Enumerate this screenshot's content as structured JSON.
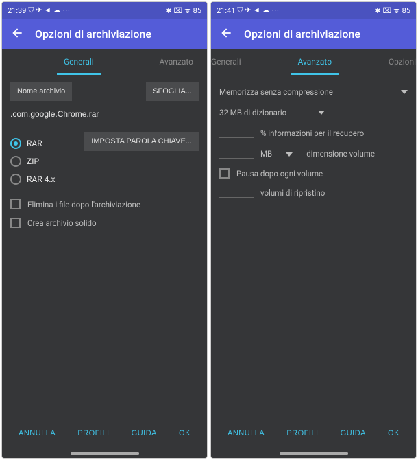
{
  "left": {
    "status_time": "21:39",
    "status_icons_left": "⛉ ✈ ◄ ☁ ⋯",
    "status_icons_right": "✱ ⌧ ᯤ 85",
    "title": "Opzioni di archiviazione",
    "tabs": {
      "generali": "Generali",
      "avanzato": "Avanzato"
    },
    "name_label": "Nome archivio",
    "browse": "SFOGLIA...",
    "filename": ".com.google.Chrome.rar",
    "formats": {
      "rar": "RAR",
      "zip": "ZIP",
      "rar4": "RAR 4.x"
    },
    "password_btn": "IMPOSTA PAROLA CHIAVE...",
    "delete_after": "Elimina i file dopo l'archiviazione",
    "solid": "Crea archivio solido",
    "footer": {
      "cancel": "ANNULLA",
      "profiles": "PROFILI",
      "help": "GUIDA",
      "ok": "OK"
    }
  },
  "right": {
    "status_time": "21:41",
    "status_icons_left": "⛉ ✈ ◄ ☁ ⋯",
    "status_icons_right": "✱ ⌧ ᯤ 85",
    "title": "Opzioni di archiviazione",
    "tabs": {
      "generali": "Generali",
      "avanzato": "Avanzato",
      "opzioni": "Opzioni"
    },
    "store_no_comp": "Memorizza senza compressione",
    "dict": "32 MB di dizionario",
    "pct_recovery": "% informazioni per il recupero",
    "mb": "MB",
    "vol_size": "dimensione volume",
    "pause": "Pausa dopo ogni volume",
    "recovery_vols": "volumi di ripristino",
    "footer": {
      "cancel": "ANNULLA",
      "profiles": "PROFILI",
      "help": "GUIDA",
      "ok": "OK"
    }
  }
}
